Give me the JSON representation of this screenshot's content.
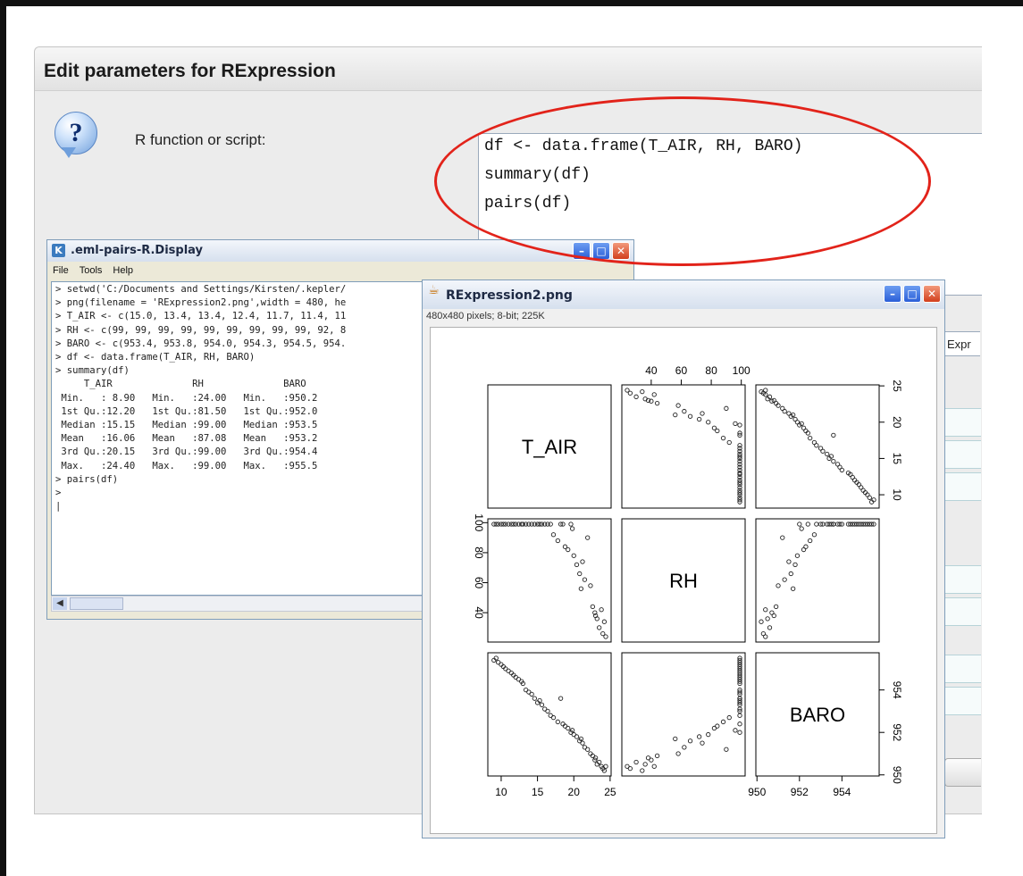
{
  "dialog": {
    "title": "Edit parameters for RExpression",
    "help_icon_glyph": "?",
    "script_label": "R function or script:",
    "script_lines": [
      "df <- data.frame(T_AIR, RH, BARO)",
      "summary(df)",
      "pairs(df)"
    ],
    "partial_label": "Expr"
  },
  "rdisplay": {
    "title": ".eml-pairs-R.Display",
    "app_icon": "K",
    "menu": [
      "File",
      "Tools",
      "Help"
    ],
    "console_lines": [
      "> setwd('C:/Documents and Settings/Kirsten/.kepler/",
      "> png(filename = 'RExpression2.png',width = 480, he",
      "> T_AIR <- c(15.0, 13.4, 13.4, 12.4, 11.7, 11.4, 11",
      "> RH <- c(99, 99, 99, 99, 99, 99, 99, 99, 99, 92, 8",
      "> BARO <- c(953.4, 953.8, 954.0, 954.3, 954.5, 954.",
      "> df <- data.frame(T_AIR, RH, BARO)",
      "> summary(df)",
      "     T_AIR              RH              BARO",
      " Min.   : 8.90   Min.   :24.00   Min.   :950.2",
      " 1st Qu.:12.20   1st Qu.:81.50   1st Qu.:952.0",
      " Median :15.15   Median :99.00   Median :953.5",
      " Mean   :16.06   Mean   :87.08   Mean   :953.2",
      " 3rd Qu.:20.15   3rd Qu.:99.00   3rd Qu.:954.4",
      " Max.   :24.40   Max.   :99.00   Max.   :955.5",
      "> pairs(df)",
      ">",
      "|"
    ]
  },
  "image_window": {
    "title": "RExpression2.png",
    "info": "480x480 pixels; 8-bit; 225K"
  },
  "window_buttons": {
    "minimize": "–",
    "maximize": "□",
    "close": "✕"
  },
  "annotation_color": "#e2231a",
  "chart_data": {
    "type": "scatter",
    "variables": [
      "T_AIR",
      "RH",
      "BARO"
    ],
    "ranges": {
      "T_AIR": [
        8.9,
        24.4
      ],
      "RH": [
        24,
        99
      ],
      "BARO": [
        950.2,
        955.5
      ]
    },
    "axis_ticks": {
      "T_AIR": [
        "10",
        "15",
        "20",
        "25"
      ],
      "RH": [
        "40",
        "60",
        "80",
        "100"
      ],
      "BARO": [
        "950",
        "952",
        "954"
      ]
    },
    "points": [
      {
        "T_AIR": 9.0,
        "RH": 99,
        "BARO": 955.4
      },
      {
        "T_AIR": 9.3,
        "RH": 99,
        "BARO": 955.5
      },
      {
        "T_AIR": 9.6,
        "RH": 99,
        "BARO": 955.3
      },
      {
        "T_AIR": 10.0,
        "RH": 99,
        "BARO": 955.2
      },
      {
        "T_AIR": 10.3,
        "RH": 99,
        "BARO": 955.1
      },
      {
        "T_AIR": 10.6,
        "RH": 99,
        "BARO": 955.0
      },
      {
        "T_AIR": 11.0,
        "RH": 99,
        "BARO": 954.9
      },
      {
        "T_AIR": 11.4,
        "RH": 99,
        "BARO": 954.8
      },
      {
        "T_AIR": 11.7,
        "RH": 99,
        "BARO": 954.7
      },
      {
        "T_AIR": 12.0,
        "RH": 99,
        "BARO": 954.6
      },
      {
        "T_AIR": 12.4,
        "RH": 99,
        "BARO": 954.5
      },
      {
        "T_AIR": 12.8,
        "RH": 99,
        "BARO": 954.4
      },
      {
        "T_AIR": 13.0,
        "RH": 99,
        "BARO": 954.3
      },
      {
        "T_AIR": 13.4,
        "RH": 99,
        "BARO": 954.0
      },
      {
        "T_AIR": 13.8,
        "RH": 99,
        "BARO": 953.9
      },
      {
        "T_AIR": 14.2,
        "RH": 99,
        "BARO": 953.8
      },
      {
        "T_AIR": 14.6,
        "RH": 99,
        "BARO": 953.6
      },
      {
        "T_AIR": 15.0,
        "RH": 99,
        "BARO": 953.4
      },
      {
        "T_AIR": 15.3,
        "RH": 99,
        "BARO": 953.5
      },
      {
        "T_AIR": 15.6,
        "RH": 99,
        "BARO": 953.3
      },
      {
        "T_AIR": 16.0,
        "RH": 99,
        "BARO": 953.1
      },
      {
        "T_AIR": 16.4,
        "RH": 99,
        "BARO": 953.0
      },
      {
        "T_AIR": 16.8,
        "RH": 99,
        "BARO": 952.8
      },
      {
        "T_AIR": 17.2,
        "RH": 92,
        "BARO": 952.7
      },
      {
        "T_AIR": 17.8,
        "RH": 88,
        "BARO": 952.5
      },
      {
        "T_AIR": 18.2,
        "RH": 99,
        "BARO": 953.6
      },
      {
        "T_AIR": 18.8,
        "RH": 84,
        "BARO": 952.3
      },
      {
        "T_AIR": 19.2,
        "RH": 82,
        "BARO": 952.2
      },
      {
        "T_AIR": 19.6,
        "RH": 99,
        "BARO": 952.0
      },
      {
        "T_AIR": 20.0,
        "RH": 78,
        "BARO": 951.9
      },
      {
        "T_AIR": 20.4,
        "RH": 72,
        "BARO": 951.8
      },
      {
        "T_AIR": 20.8,
        "RH": 66,
        "BARO": 951.6
      },
      {
        "T_AIR": 21.2,
        "RH": 74,
        "BARO": 951.5
      },
      {
        "T_AIR": 21.5,
        "RH": 62,
        "BARO": 951.3
      },
      {
        "T_AIR": 21.9,
        "RH": 90,
        "BARO": 951.2
      },
      {
        "T_AIR": 22.3,
        "RH": 58,
        "BARO": 951.0
      },
      {
        "T_AIR": 22.6,
        "RH": 44,
        "BARO": 950.9
      },
      {
        "T_AIR": 22.9,
        "RH": 40,
        "BARO": 950.7
      },
      {
        "T_AIR": 23.2,
        "RH": 36,
        "BARO": 950.5
      },
      {
        "T_AIR": 23.5,
        "RH": 30,
        "BARO": 950.6
      },
      {
        "T_AIR": 23.8,
        "RH": 42,
        "BARO": 950.4
      },
      {
        "T_AIR": 24.0,
        "RH": 26,
        "BARO": 950.3
      },
      {
        "T_AIR": 24.2,
        "RH": 34,
        "BARO": 950.2
      },
      {
        "T_AIR": 24.4,
        "RH": 24,
        "BARO": 950.4
      },
      {
        "T_AIR": 23.0,
        "RH": 38,
        "BARO": 950.8
      },
      {
        "T_AIR": 21.0,
        "RH": 56,
        "BARO": 951.7
      },
      {
        "T_AIR": 19.8,
        "RH": 96,
        "BARO": 952.1
      },
      {
        "T_AIR": 18.5,
        "RH": 99,
        "BARO": 952.4
      }
    ]
  }
}
